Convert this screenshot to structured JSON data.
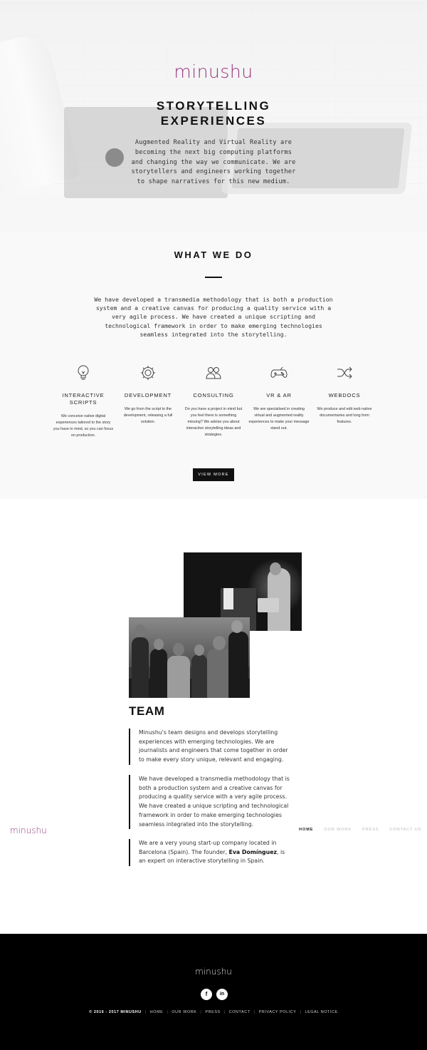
{
  "hero": {
    "logo": "minushu",
    "title_line1": "STORYTELLING",
    "title_line2": "EXPERIENCES",
    "text": "Augmented Reality and Virtual Reality are becoming the next big computing platforms and changing the way we communicate. We are storytellers and engineers working together to shape narratives for this new medium."
  },
  "what_we_do": {
    "title": "WHAT WE DO",
    "text": "We have developed a transmedia methodology that is both a production system and a creative canvas for producing a quality service with a very agile process. We have created a unique scripting and technological framework in order to make emerging technologies seamless integrated into the storytelling.",
    "services": [
      {
        "icon": "lightbulb-icon",
        "name": "INTERACTIVE SCRIPTS",
        "desc": "We conceive native digital experiences tailored to the story you have in mind, so you can focus on production."
      },
      {
        "icon": "gear-icon",
        "name": "DEVELOPMENT",
        "desc": "We go from the script to the development, releasing a full solution."
      },
      {
        "icon": "users-icon",
        "name": "CONSULTING",
        "desc": "Do you have a project in mind but you feel there is something missing? We advise you about interactive storytelling ideas and strategies."
      },
      {
        "icon": "gamepad-icon",
        "name": "VR & AR",
        "desc": "We are specialised in creating virtual and augmented reality experiences to make your message stand out."
      },
      {
        "icon": "shuffle-icon",
        "name": "WEBDOCS",
        "desc": "We produce and edit web native documentaries and long form features."
      }
    ],
    "button": "VIEW MORE"
  },
  "team": {
    "title": "TEAM",
    "p1": "Minushu's team designs and develops storytelling experiences with emerging technologies. We are journalists and engineers that come together in order to make every story unique, relevant and engaging.",
    "p2": "We have developed a transmedia methodology that is both a production system and a creative canvas for producing a quality service with a very agile process. We have created a unique scripting and technological framework in order to make emerging technologies seamless integrated into the storytelling.",
    "p3_before": "We are a very young start-up company located in Barcelona (Spain). The founder,",
    "p3_name": "Eva Domínguez",
    "p3_after": ", is an expert on interactive storytelling in Spain."
  },
  "side_nav": {
    "logo": "minushu",
    "items": [
      "HOME",
      "OUR WORK",
      "PRESS",
      "CONTACT US"
    ]
  },
  "footer": {
    "logo": "minushu",
    "facebook": "f",
    "linkedin": "in",
    "copyright": "© 2016 - 2017 MINUSHU",
    "links": [
      "HOME",
      "OUR WORK",
      "PRESS",
      "CONTACT",
      "PRIVACY POLICY",
      "LEGAL NOTICE"
    ]
  },
  "colors": {
    "brand": "#97367f",
    "dark": "#111111",
    "footer_bg": "#000000"
  }
}
